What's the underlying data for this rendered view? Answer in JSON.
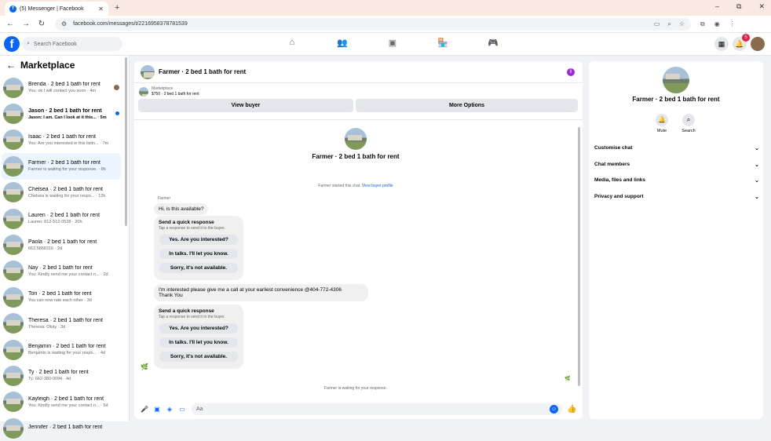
{
  "browser": {
    "tab_title": "(5) Messenger | Facebook",
    "tab_close": "✕",
    "new_tab": "+",
    "url": "facebook.com/messages/t/2216958378781539",
    "window_controls": [
      "–",
      "⧉",
      "✕"
    ]
  },
  "fb": {
    "search_placeholder": "Search Facebook",
    "notifications_badge": "5",
    "nav_icons": [
      "home-icon",
      "friends-icon",
      "watch-icon",
      "marketplace-icon",
      "gaming-icon"
    ]
  },
  "sidebar": {
    "title": "Marketplace",
    "conversations": [
      {
        "title": "Brenda · 2 bed 1 bath for rent",
        "preview": "You: ok I will contact you soon · 4m"
      },
      {
        "title": "Jason · 2 bed 1 bath for rent",
        "preview": "Jason: I am. Can I look at it this... · 5m"
      },
      {
        "title": "Isaac · 2 bed 1 bath for rent",
        "preview": "You: Are you interested in this listin... · 7m"
      },
      {
        "title": "Farmer · 2 bed 1 bath for rent",
        "preview": "Farmer is waiting for your response. · 8h"
      },
      {
        "title": "Chelsea · 2 bed 1 bath for rent",
        "preview": "Chelsea is waiting for your respo... · 12h"
      },
      {
        "title": "Lauren · 2 bed 1 bath for rent",
        "preview": "Lauren: 812-512-0528 · 20h"
      },
      {
        "title": "Paola · 2 bed 1 bath for rent",
        "preview": "662.5868316 · 2d"
      },
      {
        "title": "Nay · 2 bed 1 bath for rent",
        "preview": "You: Kindly send me your contact n... · 2d"
      },
      {
        "title": "Tori · 2 bed 1 bath for rent",
        "preview": "You can now rate each other · 3d"
      },
      {
        "title": "Theresa · 2 bed 1 bath for rent",
        "preview": "Theresa: Okay · 3d"
      },
      {
        "title": "Benjamin · 2 bed 1 bath for rent",
        "preview": "Benjamin is waiting for your respo... · 4d"
      },
      {
        "title": "Ty · 2 bed 1 bath for rent",
        "preview": "Ty: 662-380-0094 · 4d"
      },
      {
        "title": "Kayleigh · 2 bed 1 bath for rent",
        "preview": "You: Kindly send me your contact n... · 5d"
      },
      {
        "title": "Jennifer · 2 bed 1 bath for rent",
        "preview": ""
      }
    ]
  },
  "chat": {
    "title": "Farmer · 2 bed 1 bath for rent",
    "marketplace_label": "Marketplace",
    "listing": "$750 · 2 bed 1 bath for rent",
    "view_buyer": "View buyer",
    "more_options": "More Options",
    "started_text": "Farmer started this chat. ",
    "view_buyer_profile": "View buyer profile",
    "sender": "Farmer",
    "msg1": "Hi, is this available?",
    "quick_title": "Send a quick response",
    "quick_sub": "Tap a response to send it to the buyer.",
    "quick_options": [
      "Yes. Are you interested?",
      "In talks. I'll let you know.",
      "Sorry, it's not available."
    ],
    "msg2_line1": "I'm interested please give me a call at your earliest convenience @404-772-4306",
    "msg2_line2": "Thank You",
    "waiting": "Farmer is waiting for your response.",
    "input_placeholder": "Aa"
  },
  "details": {
    "title": "Farmer · 2 bed 1 bath for rent",
    "mute": "Mute",
    "search": "Search",
    "sections": [
      "Customise chat",
      "Chat members",
      "Media, files and links",
      "Privacy and support"
    ]
  },
  "colors": {
    "accent": "#0866ff",
    "selected_bg": "#ebf5ff",
    "bubble": "#f0f0f0"
  }
}
